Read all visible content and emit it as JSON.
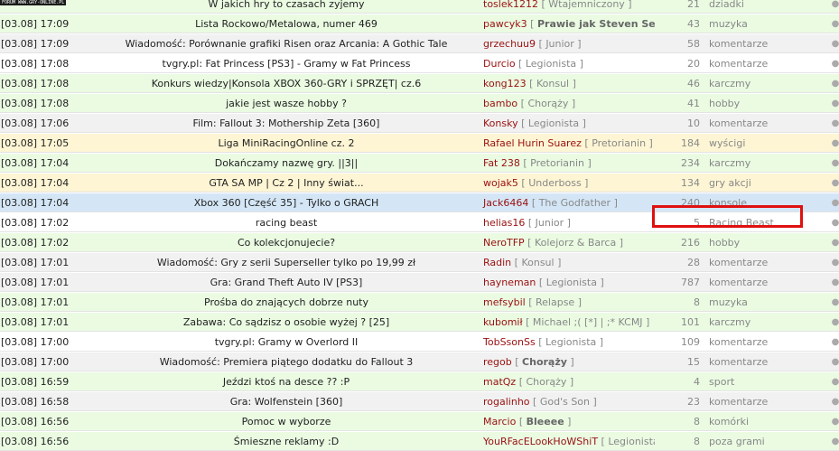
{
  "logo_text": "FORUM WWW.GRY-ONLINE.PL",
  "rows": [
    {
      "time": "",
      "title": "W jakich hry to czasach zyjemy",
      "nick": "toslek1212",
      "rank": "Wtajemniczony",
      "rank_bold": false,
      "count": "21",
      "forum": "dziadki",
      "bg": "green"
    },
    {
      "time": "[03.08] 17:09",
      "title": "Lista Rockowo/Metalowa, numer 469",
      "nick": "pawcyk3",
      "rank": "Prawie jak Steven Seagal",
      "rank_bold": true,
      "count": "43",
      "forum": "muzyka",
      "bg": "green"
    },
    {
      "time": "[03.08] 17:09",
      "title": "Wiadomość: Porównanie grafiki Risen oraz Arcania: A Gothic Tale",
      "nick": "grzechuu9",
      "rank": "Junior",
      "rank_bold": false,
      "count": "58",
      "forum": "komentarze",
      "bg": "gray"
    },
    {
      "time": "[03.08] 17:08",
      "title": "tvgry.pl: Fat Princess [PS3] - Gramy w Fat Princess",
      "nick": "Durcio",
      "rank": "Legionista",
      "rank_bold": false,
      "count": "20",
      "forum": "komentarze",
      "bg": "white"
    },
    {
      "time": "[03.08] 17:08",
      "title": "Konkurs wiedzy|Konsola XBOX 360-GRY i SPRZĘT| cz.6",
      "nick": "kong123",
      "rank": "Konsul",
      "rank_bold": false,
      "count": "46",
      "forum": "karczmy",
      "bg": "green"
    },
    {
      "time": "[03.08] 17:08",
      "title": "jakie jest wasze hobby ?",
      "nick": "bambo",
      "rank": "Chorąży",
      "rank_bold": false,
      "count": "41",
      "forum": "hobby",
      "bg": "green"
    },
    {
      "time": "[03.08] 17:06",
      "title": "Film: Fallout 3: Mothership Zeta [360]",
      "nick": "Konsky",
      "rank": "Legionista",
      "rank_bold": false,
      "count": "10",
      "forum": "komentarze",
      "bg": "gray"
    },
    {
      "time": "[03.08] 17:05",
      "title": "Liga MiniRacingOnline cz. 2",
      "nick": "Rafael Hurin Suarez",
      "rank": "Pretorianin",
      "rank_bold": false,
      "count": "184",
      "forum": "wyścigi",
      "bg": "yellow"
    },
    {
      "time": "[03.08] 17:04",
      "title": "Dokańczamy nazwę gry. ||3||",
      "nick": "Fat 238",
      "rank": "Pretorianin",
      "rank_bold": false,
      "count": "234",
      "forum": "karczmy",
      "bg": "green"
    },
    {
      "time": "[03.08] 17:04",
      "title": "GTA SA MP | Cz 2 | Inny świat...",
      "nick": "wojak5",
      "rank": "Underboss",
      "rank_bold": false,
      "count": "134",
      "forum": "gry akcji",
      "bg": "yellow"
    },
    {
      "time": "[03.08] 17:04",
      "title": "Xbox 360 [Część 35] - Tylko o GRACH",
      "nick": "Jack6464",
      "rank": "The Godfather",
      "rank_bold": false,
      "count": "240",
      "forum": "konsole",
      "bg": "blue"
    },
    {
      "time": "[03.08] 17:02",
      "title": "racing beast",
      "nick": "helias16",
      "rank": "Junior",
      "rank_bold": false,
      "count": "5",
      "forum": "Racing Beast",
      "bg": "white"
    },
    {
      "time": "[03.08] 17:02",
      "title": "Co kolekcjonujecie?",
      "nick": "NeroTFP",
      "rank": "Kolejorz & Barca",
      "rank_bold": false,
      "count": "216",
      "forum": "hobby",
      "bg": "green"
    },
    {
      "time": "[03.08] 17:01",
      "title": "Wiadomość: Gry z serii Superseller tylko po 19,99 zł",
      "nick": "Radin",
      "rank": "Konsul",
      "rank_bold": false,
      "count": "28",
      "forum": "komentarze",
      "bg": "gray"
    },
    {
      "time": "[03.08] 17:01",
      "title": "Gra: Grand Theft Auto IV [PS3]",
      "nick": "hayneman",
      "rank": "Legionista",
      "rank_bold": false,
      "count": "787",
      "forum": "komentarze",
      "bg": "gray"
    },
    {
      "time": "[03.08] 17:01",
      "title": "Prośba do znających dobrze nuty",
      "nick": "mefsybil",
      "rank": "Relapse",
      "rank_bold": false,
      "count": "8",
      "forum": "muzyka",
      "bg": "green"
    },
    {
      "time": "[03.08] 17:01",
      "title": "Zabawa: Co sądzisz o osobie wyżej ? [25]",
      "nick": "kubomił",
      "rank": "Michael ;( [*] | ;* KCMJ",
      "rank_bold": false,
      "count": "101",
      "forum": "karczmy",
      "bg": "green"
    },
    {
      "time": "[03.08] 17:00",
      "title": "tvgry.pl: Gramy w Overlord II",
      "nick": "TobSsonSs",
      "rank": "Legionista",
      "rank_bold": false,
      "count": "109",
      "forum": "komentarze",
      "bg": "white"
    },
    {
      "time": "[03.08] 17:00",
      "title": "Wiadomość: Premiera piątego dodatku do Fallout 3",
      "nick": "regob",
      "rank": "Chorąży",
      "rank_bold": true,
      "count": "15",
      "forum": "komentarze",
      "bg": "gray"
    },
    {
      "time": "[03.08] 16:59",
      "title": "Jeździ ktoś na desce ?? :P",
      "nick": "matQz",
      "rank": "Chorąży",
      "rank_bold": false,
      "count": "4",
      "forum": "sport",
      "bg": "green"
    },
    {
      "time": "[03.08] 16:58",
      "title": "Gra: Wolfenstein [360]",
      "nick": "rogalinho",
      "rank": "God's Son",
      "rank_bold": false,
      "count": "23",
      "forum": "komentarze",
      "bg": "gray"
    },
    {
      "time": "[03.08] 16:56",
      "title": "Pomoc w wyborze",
      "nick": "Marcio",
      "rank": "Bleeee",
      "rank_bold": true,
      "count": "8",
      "forum": "komórki",
      "bg": "green"
    },
    {
      "time": "[03.08] 16:56",
      "title": "Śmieszne reklamy :D",
      "nick": "YouRFacELookHoWShiT",
      "rank": "Legionista",
      "rank_bold": false,
      "count": "8",
      "forum": "poza grami",
      "bg": "green"
    }
  ]
}
